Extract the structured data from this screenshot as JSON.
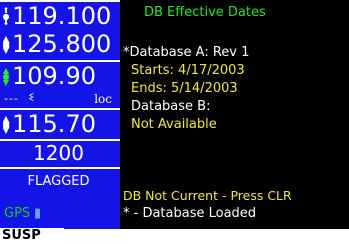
{
  "left_panel": {
    "com_active": "119.100",
    "com_standby": "125.800",
    "nav_active": "109.90",
    "nav_sub_arrows": "---",
    "nav_sub_icon": "ident-icon",
    "nav_sub_label": "loc",
    "nav_standby": "115.70",
    "transponder_code": "1200",
    "status": "FLAGGED",
    "gps_label": "GPS"
  },
  "bottom_bar": {
    "mode": "SUSP"
  },
  "page": {
    "title": "DB Effective Dates",
    "db_a_label": "*Database A: Rev 1",
    "db_a_starts": "Starts: 4/17/2003",
    "db_a_ends": "Ends:  5/14/2003",
    "db_b_label": "Database B:",
    "db_b_status": "Not Available",
    "message": "DB Not Current - Press CLR",
    "legend": "* - Database Loaded"
  },
  "colors": {
    "left_panel_bg": "#1414e6",
    "page_bg": "#000000",
    "title_green": "#21e821",
    "value_yellow": "#f0e83c"
  }
}
